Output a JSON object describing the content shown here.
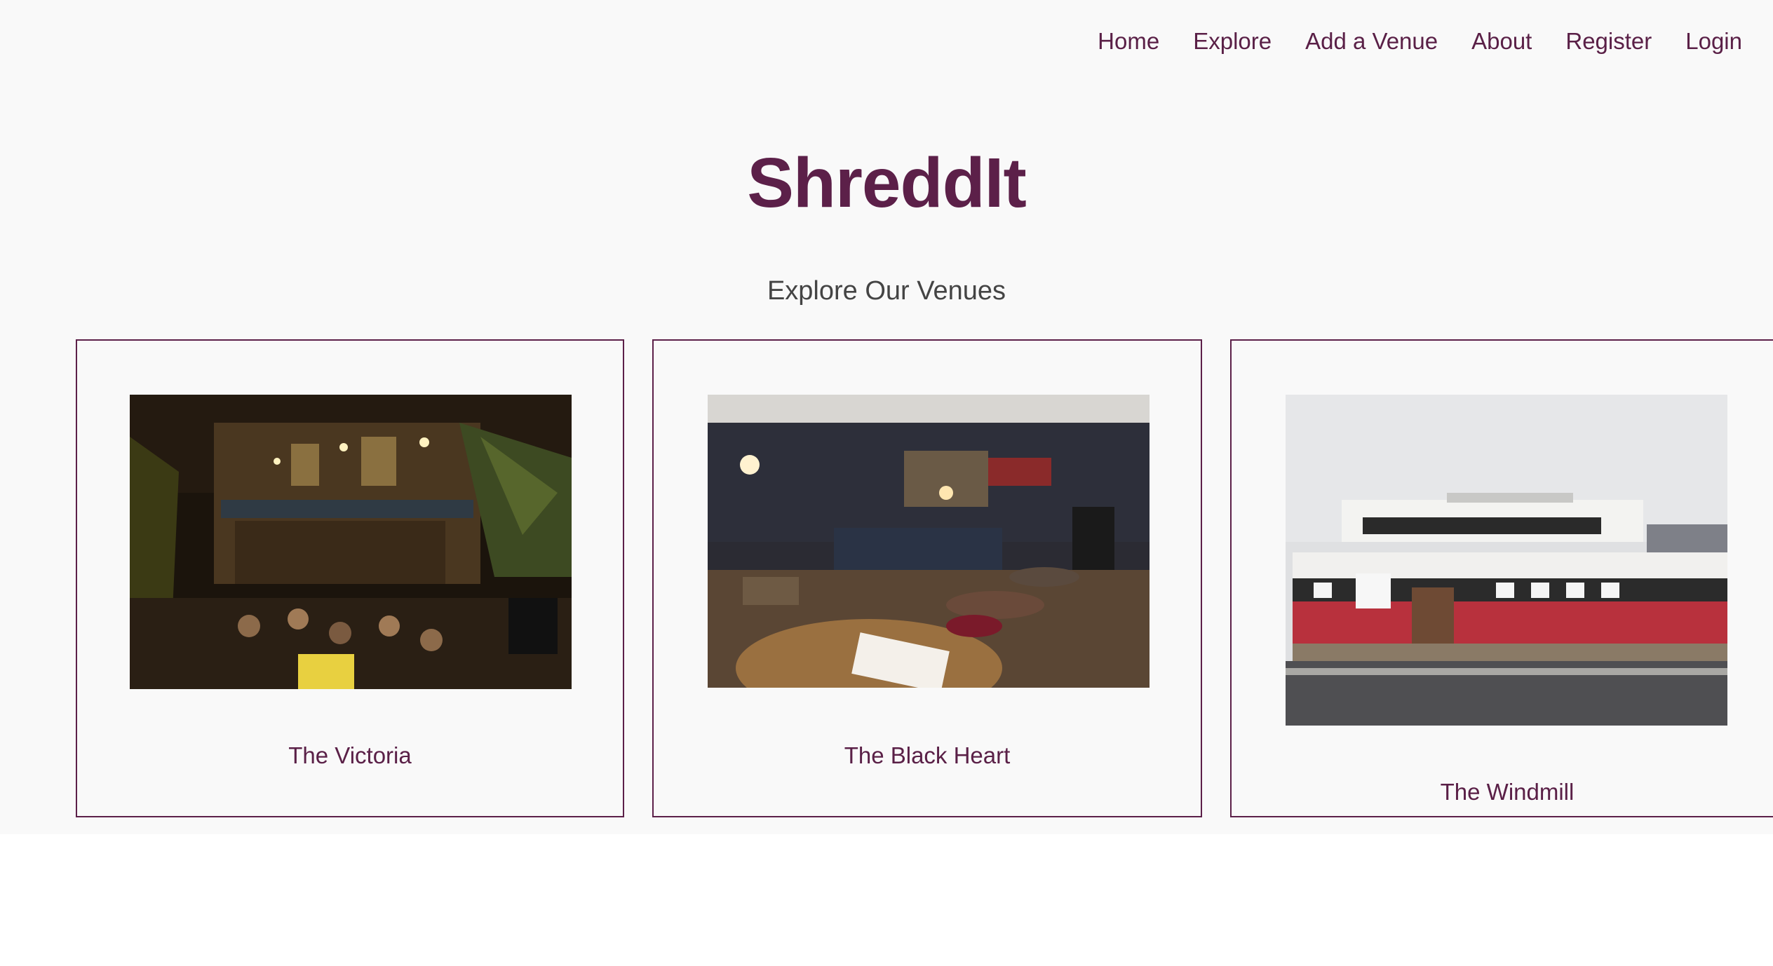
{
  "nav": {
    "items": [
      "Home",
      "Explore",
      "Add a Venue",
      "About",
      "Register",
      "Login"
    ]
  },
  "brand": "ShreddIt",
  "subtitle": "Explore Our Venues",
  "venues": [
    {
      "name": "The Victoria",
      "image": "pub-exterior-night-photo"
    },
    {
      "name": "The Black Heart",
      "image": "bar-interior-photo"
    },
    {
      "name": "The Windmill",
      "image": "venue-building-exterior-photo"
    }
  ],
  "colors": {
    "brand": "#5c2049",
    "link": "#5a2047",
    "background": "#f9f9f9",
    "subtitle": "#444444"
  }
}
